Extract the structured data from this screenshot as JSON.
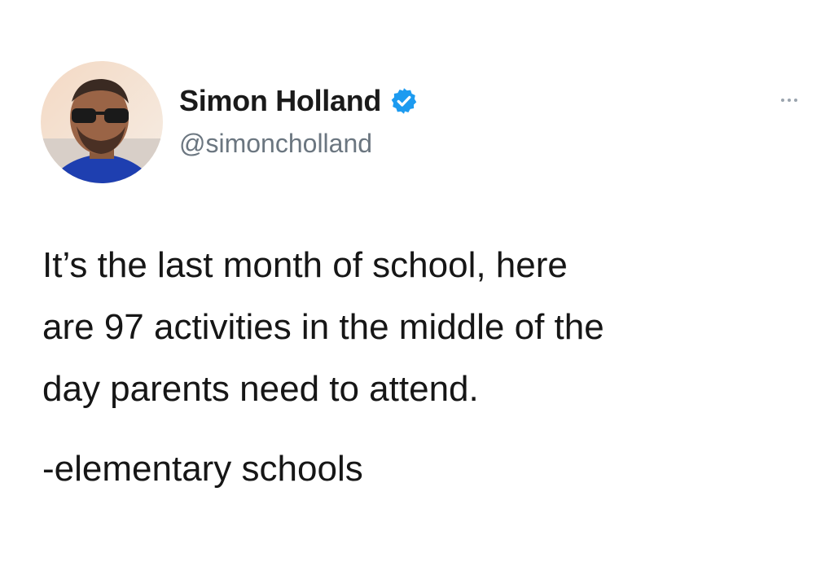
{
  "tweet": {
    "author": {
      "display_name": "Simon Holland",
      "handle": "@simoncholland",
      "verified": true,
      "verified_badge_color": "#1d9bf0",
      "avatar_icon": "profile-photo"
    },
    "more_menu_icon": "ellipsis-icon",
    "body_lines": [
      "It’s the last month of school, here",
      "are 97 activities in the middle of the",
      "day parents need to attend."
    ],
    "signoff": "-elementary schools"
  }
}
